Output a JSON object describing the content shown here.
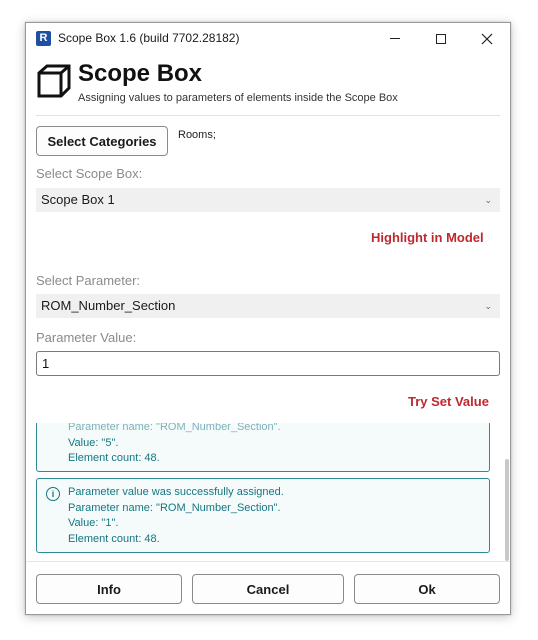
{
  "window": {
    "title": "Scope Box  1.6 (build 7702.28182)",
    "app_icon_letter": "R",
    "controls": {
      "minimize": "minimize-icon",
      "maximize": "maximize-icon",
      "close": "✕"
    }
  },
  "header": {
    "title": "Scope Box",
    "subtitle": "Assigning values to parameters of elements inside the Scope Box",
    "icon": "cube-outline-icon"
  },
  "categories": {
    "button_label": "Select Categories",
    "selected": "Rooms;"
  },
  "scope_box": {
    "label": "Select Scope Box:",
    "value": "Scope Box 1",
    "highlight_label": "Highlight in Model"
  },
  "parameter": {
    "label": "Select Parameter:",
    "value": "ROM_Number_Section"
  },
  "parameter_value": {
    "label": "Parameter Value:",
    "value": "1",
    "action_label": "Try Set Value"
  },
  "log": {
    "previous": {
      "lines": [
        "Parameter name: \"ROM_Number_Section\".",
        "Value: \"5\".",
        "Element count: 48."
      ]
    },
    "current": {
      "lines": [
        "Parameter value was successfully assigned.",
        "Parameter name: \"ROM_Number_Section\".",
        "Value: \"1\".",
        "Element count: 48."
      ]
    }
  },
  "footer": {
    "info_label": "Info",
    "cancel_label": "Cancel",
    "ok_label": "Ok"
  },
  "colors": {
    "accent_action": "#c0282d",
    "log_text": "#177680",
    "log_border": "#2f8a93"
  }
}
